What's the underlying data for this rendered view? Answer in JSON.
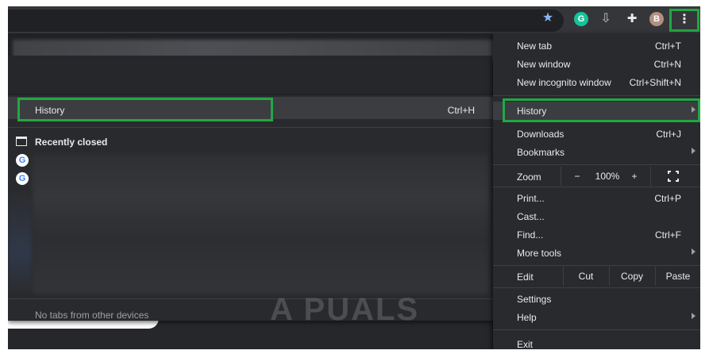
{
  "toolbar": {
    "star_icon": "star-icon",
    "grammarly_letter": "G",
    "avatar_letter": "B",
    "menu_icon": "⋮"
  },
  "submenu": {
    "history_label": "History",
    "history_shortcut": "Ctrl+H",
    "recently_closed_label": "Recently closed",
    "google_letter": "G",
    "no_tabs_text": "No tabs from other devices"
  },
  "watermark": "A PUALS",
  "menu": {
    "new_tab": {
      "label": "New tab",
      "shortcut": "Ctrl+T"
    },
    "new_window": {
      "label": "New window",
      "shortcut": "Ctrl+N"
    },
    "new_incognito": {
      "label": "New incognito window",
      "shortcut": "Ctrl+Shift+N"
    },
    "history": {
      "label": "History"
    },
    "downloads": {
      "label": "Downloads",
      "shortcut": "Ctrl+J"
    },
    "bookmarks": {
      "label": "Bookmarks"
    },
    "zoom": {
      "label": "Zoom",
      "minus": "−",
      "value": "100%",
      "plus": "+"
    },
    "print": {
      "label": "Print...",
      "shortcut": "Ctrl+P"
    },
    "cast": {
      "label": "Cast..."
    },
    "find": {
      "label": "Find...",
      "shortcut": "Ctrl+F"
    },
    "more_tools": {
      "label": "More tools"
    },
    "edit": {
      "label": "Edit",
      "cut": "Cut",
      "copy": "Copy",
      "paste": "Paste"
    },
    "settings": {
      "label": "Settings"
    },
    "help": {
      "label": "Help"
    },
    "exit": {
      "label": "Exit"
    }
  },
  "colors": {
    "highlight_box": "#22a745",
    "menu_bg": "#292a2d",
    "accent_star": "#8ab4f8"
  }
}
